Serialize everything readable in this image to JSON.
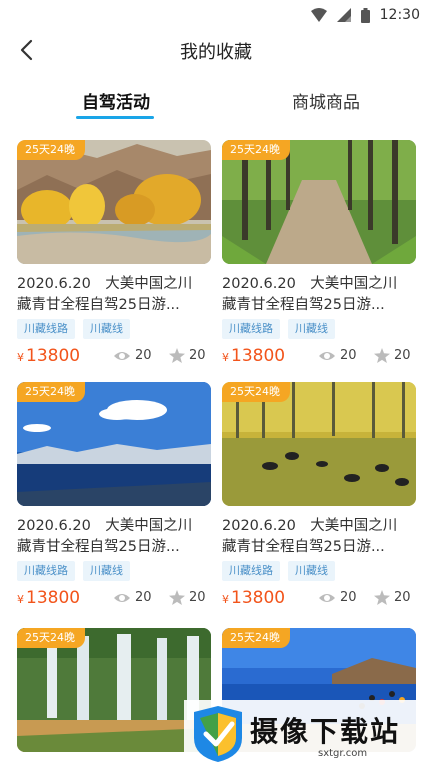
{
  "status": {
    "time": "12:30"
  },
  "header": {
    "title": "我的收藏"
  },
  "tabs": [
    {
      "label": "自驾活动"
    },
    {
      "label": "商城商品"
    }
  ],
  "cards": [
    {
      "badge": "25天24晚",
      "title_line1": "2020.6.20　大美中国之川",
      "title_line2": "藏青甘全程自驾25日游...",
      "tags": [
        "川藏线路",
        "川藏线"
      ],
      "currency": "¥",
      "price": "13800",
      "views": "20",
      "stars": "20"
    },
    {
      "badge": "25天24晚",
      "title_line1": "2020.6.20　大美中国之川",
      "title_line2": "藏青甘全程自驾25日游...",
      "tags": [
        "川藏线路",
        "川藏线"
      ],
      "currency": "¥",
      "price": "13800",
      "views": "20",
      "stars": "20"
    },
    {
      "badge": "25天24晚",
      "title_line1": "2020.6.20　大美中国之川",
      "title_line2": "藏青甘全程自驾25日游...",
      "tags": [
        "川藏线路",
        "川藏线"
      ],
      "currency": "¥",
      "price": "13800",
      "views": "20",
      "stars": "20"
    },
    {
      "badge": "25天24晚",
      "title_line1": "2020.6.20　大美中国之川",
      "title_line2": "藏青甘全程自驾25日游...",
      "tags": [
        "川藏线路",
        "川藏线"
      ],
      "currency": "¥",
      "price": "13800",
      "views": "20",
      "stars": "20"
    },
    {
      "badge": "25天24晚"
    },
    {
      "badge": "25天24晚"
    }
  ],
  "watermark": {
    "text": "摄像下载站",
    "url": "sxtgr.com"
  }
}
